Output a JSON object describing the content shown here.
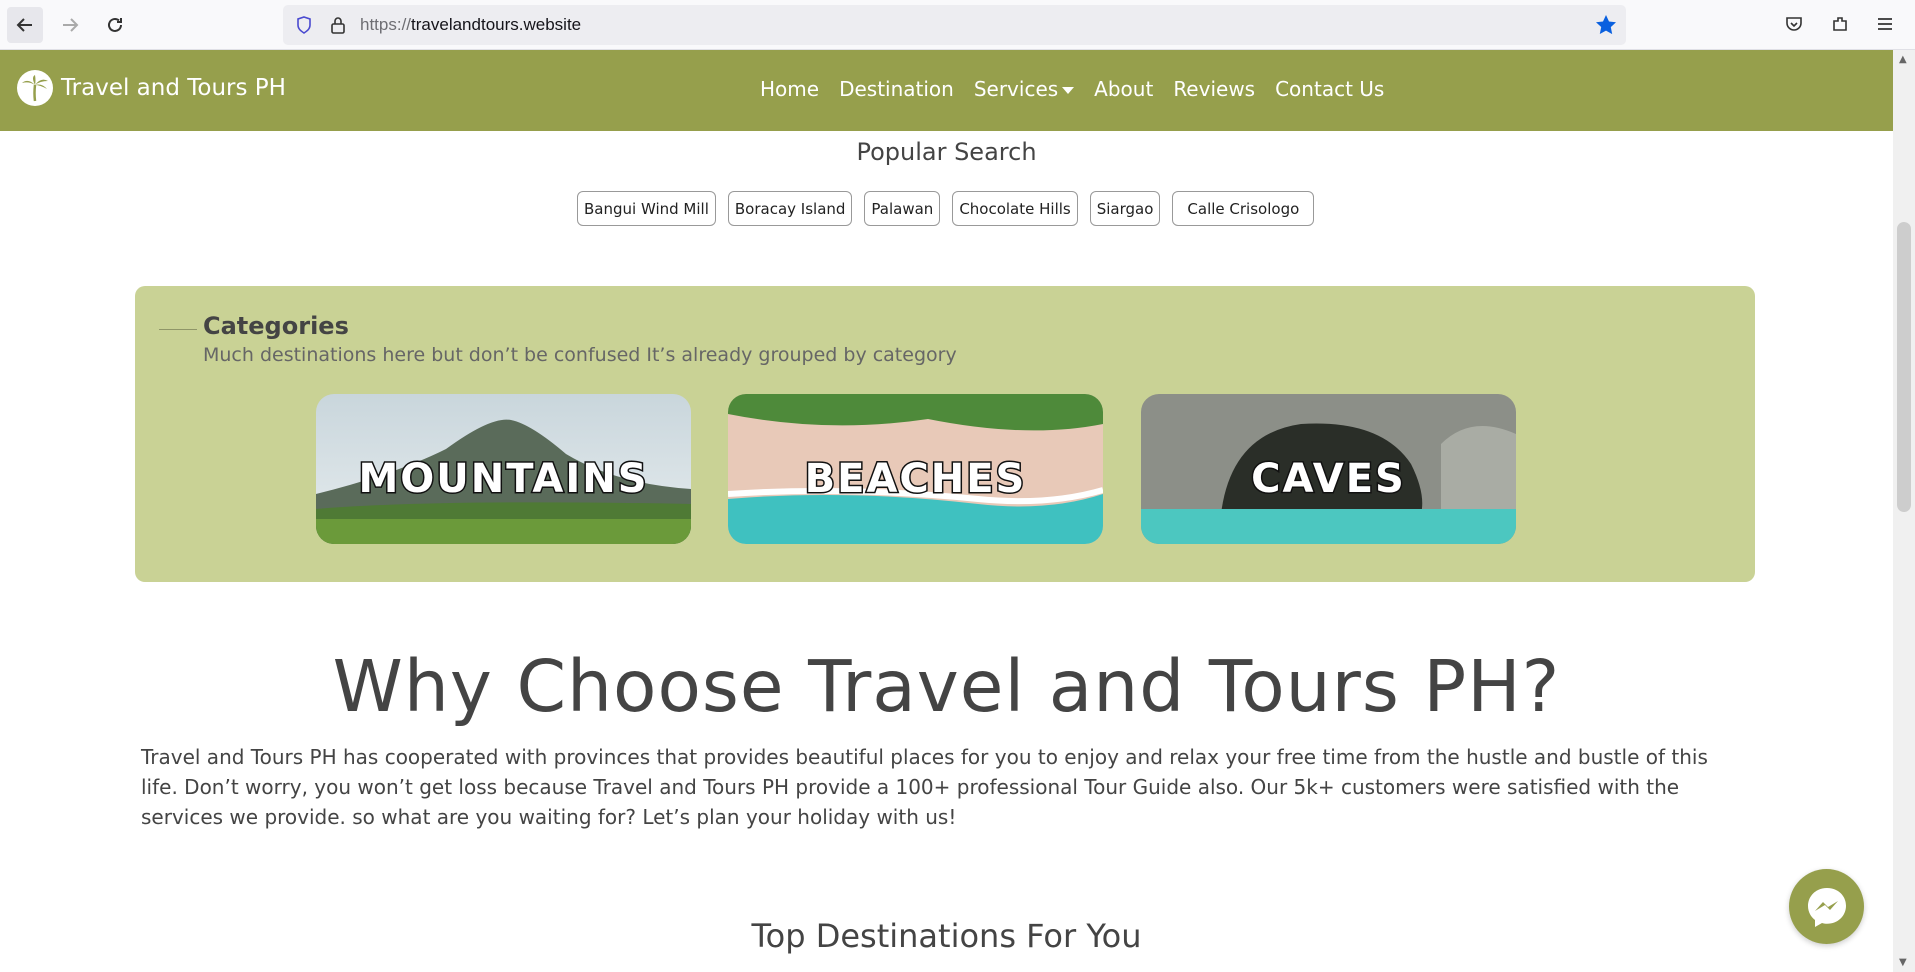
{
  "browser": {
    "url_scheme": "https://",
    "url_host": "travelandtours.website"
  },
  "navbar": {
    "brand": "Travel and Tours PH",
    "links": [
      "Home",
      "Destination",
      "Services",
      "About",
      "Reviews",
      "Contact Us"
    ],
    "background": "#969f4c"
  },
  "popular": {
    "title": "Popular Search",
    "tags": [
      "Bangui Wind Mill",
      "Boracay Island",
      "Palawan",
      "Chocolate Hills",
      "Siargao",
      "Calle Crisologo"
    ]
  },
  "categories": {
    "title": "Categories",
    "subtitle": "Much destinations here but don’t be confused It’s already grouped by category",
    "cards": [
      "MOUNTAINS",
      "BEACHES",
      "CAVES"
    ],
    "background": "#c9d295"
  },
  "why": {
    "title": "Why Choose Travel and Tours PH?",
    "text": "Travel and Tours PH has cooperated with provinces that provides beautiful places for you to enjoy and relax your free time from the hustle and bustle of this life. Don’t worry, you won’t get loss because Travel and Tours PH provide a 100+ professional Tour Guide also. Our 5k+ customers were satisfied with the services we provide. so what are you waiting for? Let’s plan your holiday with us!"
  },
  "top_destinations": {
    "title": "Top Destinations For You"
  },
  "icons": [
    "back-icon",
    "forward-icon",
    "reload-icon",
    "shield-icon",
    "lock-icon",
    "star-icon",
    "pocket-icon",
    "extensions-icon",
    "menu-icon",
    "palm-tree-icon",
    "messenger-icon"
  ]
}
